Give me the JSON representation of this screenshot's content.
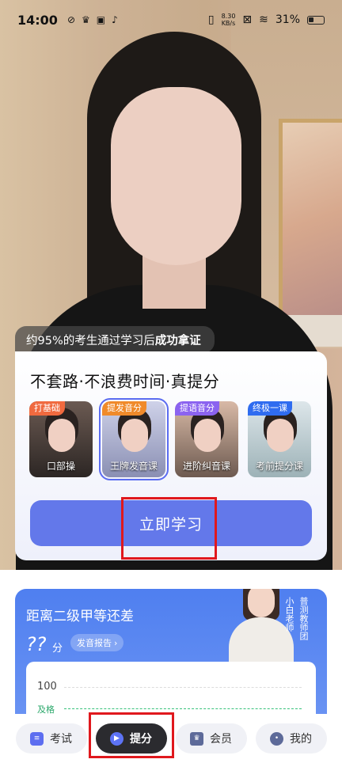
{
  "status_bar": {
    "time": "14:00",
    "net_speed_value": "8.30",
    "net_speed_unit": "KB/s",
    "battery": "31%"
  },
  "promo": {
    "stat_prefix": "约95%的考生通过学习后",
    "stat_bold": "成功拿证",
    "title": "不套路·不浪费时间·真提分",
    "courses": [
      {
        "badge": "打基础",
        "name": "口部操"
      },
      {
        "badge": "提发音分",
        "name": "王牌发音课"
      },
      {
        "badge": "提语音分",
        "name": "进阶纠音课"
      },
      {
        "badge": "终极一课",
        "name": "考前提分课"
      }
    ],
    "cta_label": "立即学习"
  },
  "score": {
    "title": "距离二级甲等还差",
    "value": "??",
    "unit": "分",
    "report_label": "发音报告",
    "teacher_caption_col1": "小白老师",
    "teacher_caption_col2": "普测教师团",
    "chart_max": "100",
    "pass_label": "及格"
  },
  "nav": {
    "items": [
      {
        "label": "考试",
        "icon": "exam-icon"
      },
      {
        "label": "提分",
        "icon": "play-icon",
        "active": true
      },
      {
        "label": "会员",
        "icon": "vip-crown-icon"
      },
      {
        "label": "我的",
        "icon": "profile-icon"
      }
    ]
  },
  "colors": {
    "accent": "#6378ea",
    "nav_active": "#2b2b2f",
    "annotation_red": "#e0181d",
    "pass_green": "#38c27b"
  }
}
